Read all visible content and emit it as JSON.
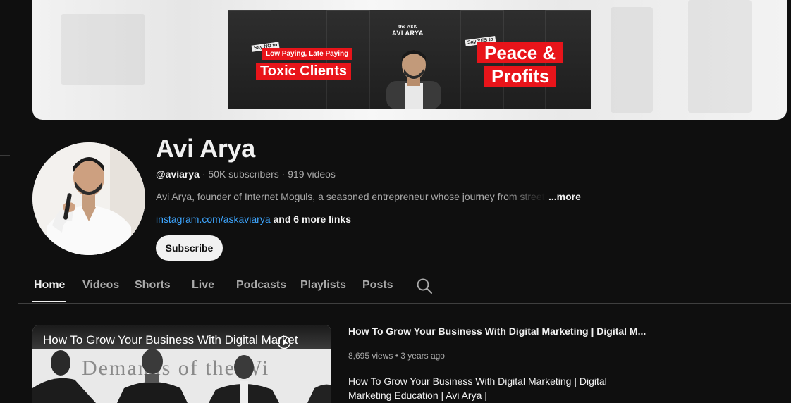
{
  "banner": {
    "left_small_tag": "Say NO to",
    "left_line1": "Low Paying, Late Paying",
    "left_line2": "Toxic Clients",
    "logo_line1": "the ASK",
    "logo_line2": "AVI ARYA",
    "right_small_tag": "Say YES to",
    "right_line1": "Peace &",
    "right_line2": "Profits"
  },
  "channel": {
    "name": "Avi Arya",
    "handle": "@aviarya",
    "subscribers": "50K subscribers",
    "videos": "919 videos",
    "description": "Avi Arya, founder of Internet Moguls, a seasoned entrepreneur whose journey from street",
    "more_label": "...more",
    "link_text": "instagram.com/askaviarya",
    "more_links": "and 6 more links",
    "subscribe_label": "Subscribe"
  },
  "tabs": [
    {
      "label": "Home"
    },
    {
      "label": "Videos"
    },
    {
      "label": "Shorts"
    },
    {
      "label": "Live"
    },
    {
      "label": "Podcasts"
    },
    {
      "label": "Playlists"
    },
    {
      "label": "Posts"
    }
  ],
  "featured": {
    "thumb_title": "How To Grow Your Business With Digital Market",
    "thumb_bg_text": "Demands of the Wi",
    "title": "How To Grow Your Business With Digital Marketing | Digital M...",
    "views": "8,695 views",
    "age": "3 years ago",
    "description": "How To Grow Your Business With Digital Marketing | Digital Marketing Education | Avi Arya |"
  },
  "colors": {
    "background": "#0f0f0f",
    "link": "#3ea6ff",
    "banner_red": "#e8141a"
  }
}
